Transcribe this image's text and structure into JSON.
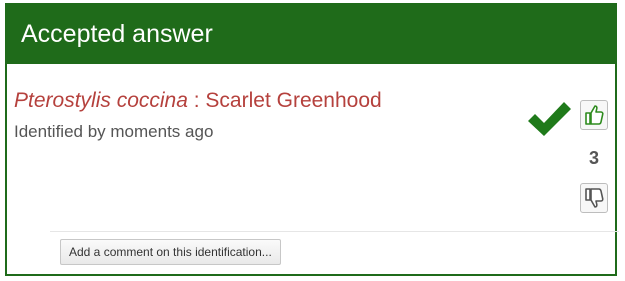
{
  "panel": {
    "header_title": "Accepted answer",
    "accent_color": "#1f6b1a"
  },
  "identification": {
    "latin_name": "Pterostylis coccina",
    "separator": " : ",
    "common_name": "Scarlet Greenhood",
    "identified_text": "Identified by moments ago",
    "name_color": "#b5413d"
  },
  "accepted_icon": "checkmark-icon",
  "votes": {
    "up_icon": "thumbs-up-icon",
    "count": "3",
    "down_icon": "thumbs-down-icon"
  },
  "comment_button_label": "Add a comment on this identification..."
}
